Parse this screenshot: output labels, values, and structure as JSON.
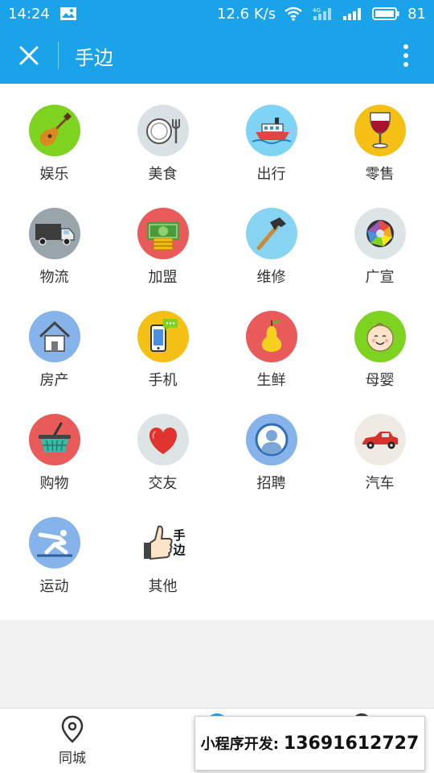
{
  "status_bar": {
    "time": "14:24",
    "speed": "12.6 K/s",
    "network": "4G",
    "battery": "81"
  },
  "app_bar": {
    "title": "手边"
  },
  "categories": [
    {
      "label": "娱乐",
      "icon": "guitar-icon",
      "color": "#7ed321"
    },
    {
      "label": "美食",
      "icon": "plate-icon",
      "color": "#d9e1e4"
    },
    {
      "label": "出行",
      "icon": "ship-icon",
      "color": "#7fd3f5"
    },
    {
      "label": "零售",
      "icon": "wine-glass-icon",
      "color": "#f5c016"
    },
    {
      "label": "物流",
      "icon": "truck-icon",
      "color": "#9aa5ab"
    },
    {
      "label": "加盟",
      "icon": "money-icon",
      "color": "#e95a5a"
    },
    {
      "label": "维修",
      "icon": "hammer-icon",
      "color": "#86d4f2"
    },
    {
      "label": "广宣",
      "icon": "aperture-icon",
      "color": "#dde4e6"
    },
    {
      "label": "房产",
      "icon": "house-icon",
      "color": "#86b4ea"
    },
    {
      "label": "手机",
      "icon": "phone-icon",
      "color": "#f5c016"
    },
    {
      "label": "生鲜",
      "icon": "pear-icon",
      "color": "#e95a5a"
    },
    {
      "label": "母婴",
      "icon": "baby-icon",
      "color": "#7ed321"
    },
    {
      "label": "购物",
      "icon": "basket-icon",
      "color": "#e95a5a"
    },
    {
      "label": "交友",
      "icon": "heart-icon",
      "color": "#dde4e6"
    },
    {
      "label": "招聘",
      "icon": "person-icon",
      "color": "#86b4ea"
    },
    {
      "label": "汽车",
      "icon": "car-icon",
      "color": "#efebe4"
    },
    {
      "label": "运动",
      "icon": "gymnast-icon",
      "color": "#86b4ea"
    },
    {
      "label": "其他",
      "icon": "thumbs-up-icon",
      "color": "#ffffff",
      "badge": "手边"
    }
  ],
  "bottom_nav": {
    "local_label": "同城"
  },
  "promo": {
    "label": "小程序开发:",
    "phone": "13691612727"
  }
}
